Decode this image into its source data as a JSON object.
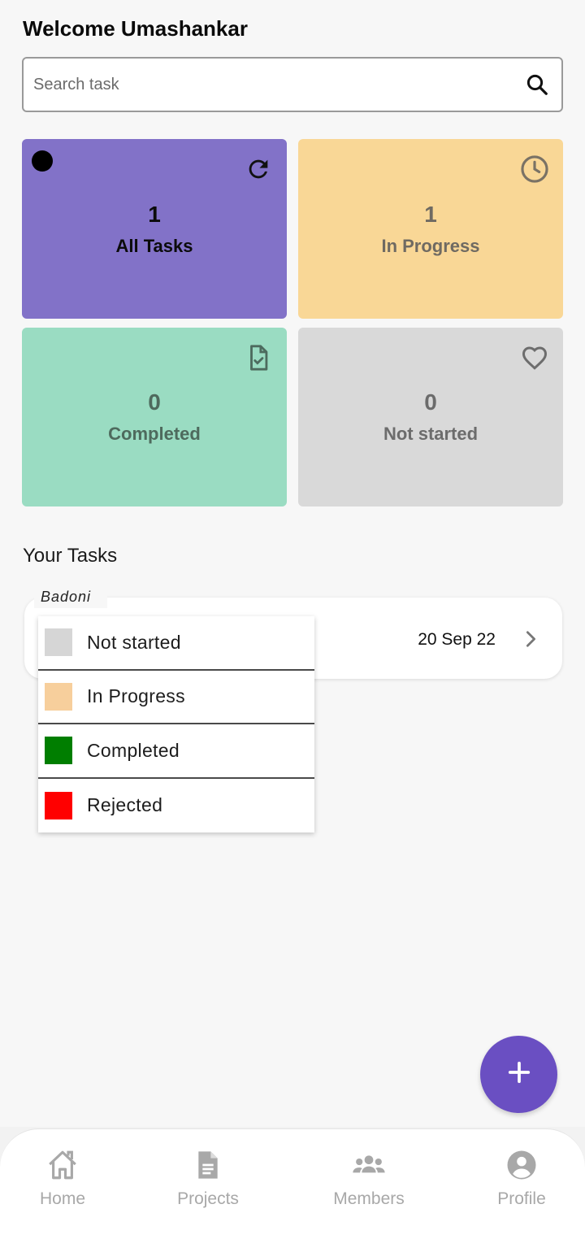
{
  "header": {
    "welcome": "Welcome Umashankar"
  },
  "search": {
    "placeholder": "Search task",
    "value": "",
    "icon": "search-icon"
  },
  "stats": [
    {
      "count": "1",
      "label": "All Tasks",
      "icon": "refresh-icon",
      "color": "#8272c8"
    },
    {
      "count": "1",
      "label": "In Progress",
      "icon": "clock-icon",
      "color": "#f9d796"
    },
    {
      "count": "0",
      "label": "Completed",
      "icon": "file-check-icon",
      "color": "#9adcc2"
    },
    {
      "count": "0",
      "label": "Not started",
      "icon": "heart-icon",
      "color": "#d9d9d9"
    }
  ],
  "tasks_section": {
    "title": "Your Tasks"
  },
  "task": {
    "project": "Badoni",
    "date": "20 Sep 22"
  },
  "legend": [
    {
      "label": "Not started",
      "color": "#d6d6d6"
    },
    {
      "label": "In Progress",
      "color": "#f7cf9c"
    },
    {
      "label": "Completed",
      "color": "#007e00"
    },
    {
      "label": "Rejected",
      "color": "#ff0000"
    }
  ],
  "fab": {
    "icon": "plus-icon"
  },
  "nav": [
    {
      "label": "Home",
      "icon": "home-icon"
    },
    {
      "label": "Projects",
      "icon": "document-icon"
    },
    {
      "label": "Members",
      "icon": "group-icon"
    },
    {
      "label": "Profile",
      "icon": "account-icon"
    }
  ]
}
